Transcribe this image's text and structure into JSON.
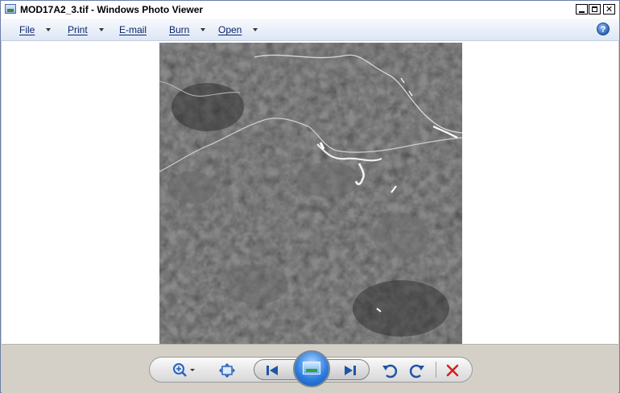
{
  "window": {
    "title": "MOD17A2_3.tif - Windows Photo Viewer",
    "icon": "photo-viewer-icon",
    "controls": {
      "minimize": "minimize-icon",
      "maximize": "maximize-icon",
      "close": "close-icon"
    }
  },
  "menu": {
    "items": [
      {
        "label": "File",
        "has_dropdown": true
      },
      {
        "label": "Print",
        "has_dropdown": true
      },
      {
        "label": "E-mail",
        "has_dropdown": false
      },
      {
        "label": "Burn",
        "has_dropdown": true
      },
      {
        "label": "Open",
        "has_dropdown": true
      }
    ],
    "help_icon": "help-icon"
  },
  "viewer": {
    "image_description": "grayscale satellite raster (MOD17A2 tile)",
    "background_color": "#ffffff"
  },
  "toolbar": {
    "buttons": [
      {
        "name": "zoom-button",
        "icon": "magnifier-plus-icon",
        "has_dropdown": true
      },
      {
        "name": "actual-size-button",
        "icon": "fit-window-icon"
      },
      {
        "name": "previous-button",
        "icon": "skip-back-icon"
      },
      {
        "name": "slideshow-button",
        "icon": "slideshow-icon"
      },
      {
        "name": "next-button",
        "icon": "skip-forward-icon"
      },
      {
        "name": "rotate-counterclockwise-button",
        "icon": "rotate-left-icon"
      },
      {
        "name": "rotate-clockwise-button",
        "icon": "rotate-right-icon"
      },
      {
        "name": "delete-button",
        "icon": "delete-x-icon"
      }
    ],
    "accent_color": "#2a62b8",
    "delete_color": "#d42020"
  }
}
